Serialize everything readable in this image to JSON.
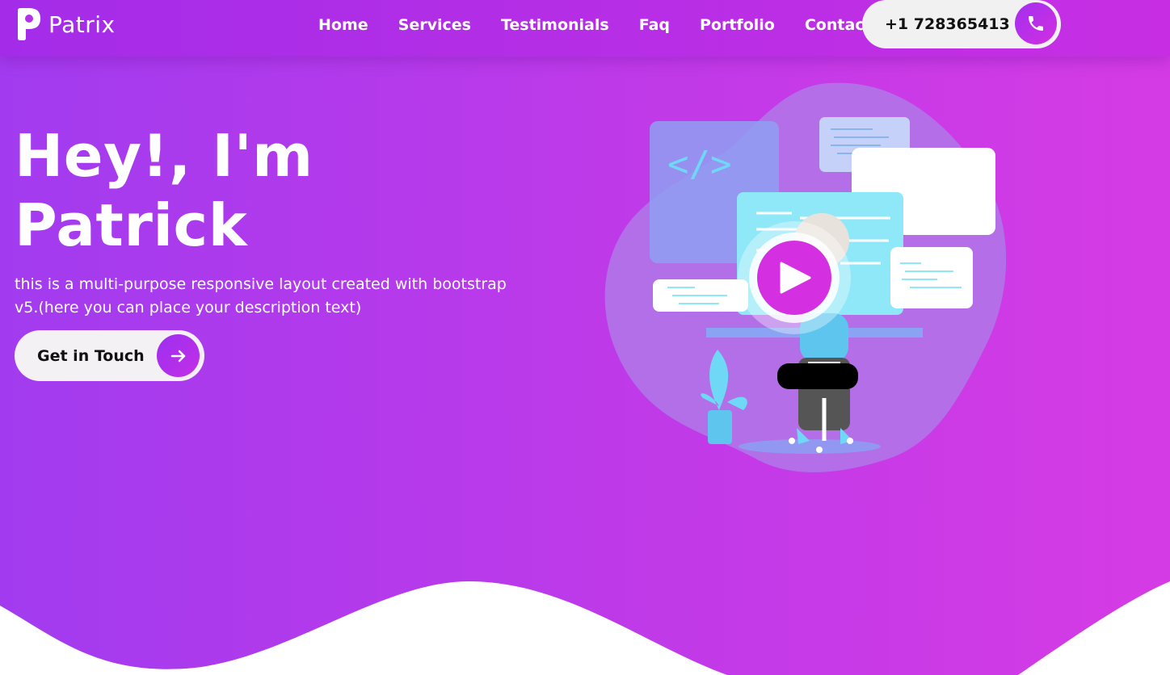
{
  "brand": {
    "name": "Patrix",
    "logo_icon": "p-logo-icon"
  },
  "nav": {
    "links": [
      "Home",
      "Services",
      "Testimonials",
      "Faq",
      "Portfolio",
      "Contact"
    ],
    "phone": "+1 728365413",
    "phone_icon": "phone-icon"
  },
  "hero": {
    "title_line1": "Hey!, I'm",
    "title_line2": "Patrick",
    "description": "this is a multi-purpose responsive layout created with bootstrap v5.(here you can place your description text)",
    "cta_label": "Get in Touch",
    "cta_icon": "arrow-right-icon",
    "illustration": "developer-illustration",
    "play_icon": "play-icon",
    "code_symbol": "</>"
  },
  "colors": {
    "accent": "#b53de9",
    "accent_dark": "#9b2ff0",
    "play": "#d42fe0",
    "screen": "#8ee8f8",
    "white": "#ffffff"
  }
}
